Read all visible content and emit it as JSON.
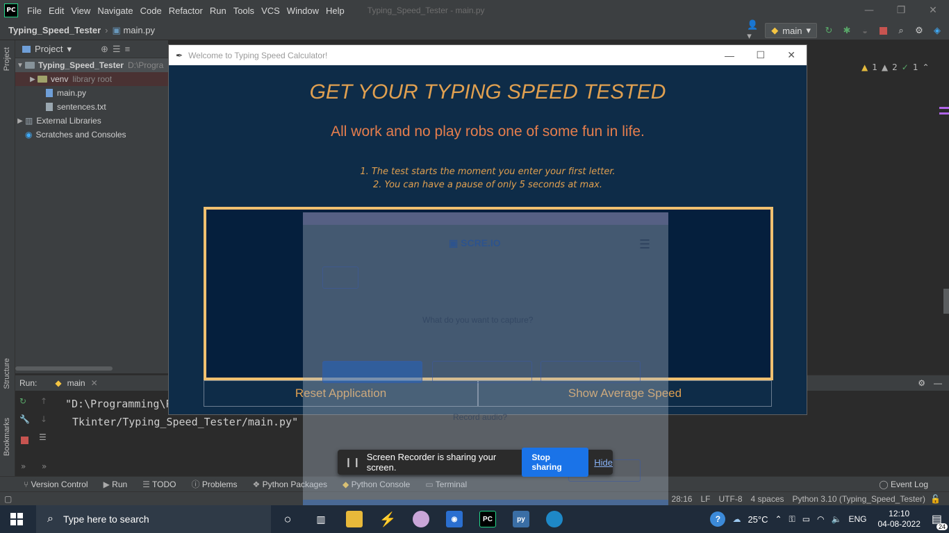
{
  "menubar": {
    "logo": "PC",
    "items": [
      "File",
      "Edit",
      "View",
      "Navigate",
      "Code",
      "Refactor",
      "Run",
      "Tools",
      "VCS",
      "Window",
      "Help"
    ],
    "title": "Typing_Speed_Tester - main.py"
  },
  "navbar": {
    "project": "Typing_Speed_Tester",
    "file": "main.py",
    "run_config": "main"
  },
  "project_panel": {
    "header": "Project",
    "root": "Typing_Speed_Tester",
    "root_path": "D:\\Progra",
    "venv": "venv",
    "venv_note": "library root",
    "main_file": "main.py",
    "sentences_file": "sentences.txt",
    "external_libraries": "External Libraries",
    "scratches": "Scratches and Consoles"
  },
  "left_strip": {
    "project": "Project",
    "structure": "Structure",
    "bookmarks": "Bookmarks"
  },
  "editor_inspections": {
    "warnings": "1",
    "weak_warnings": "2",
    "ok": "1"
  },
  "run_panel": {
    "label": "Run:",
    "tab": "main",
    "line1": "\"D:\\Programming\\P",
    "line2": "Tkinter/Typing_Speed_Tester/main.py\""
  },
  "bottom_tabs": [
    "Version Control",
    "Run",
    "TODO",
    "Problems",
    "Python Packages",
    "Python Console",
    "Terminal"
  ],
  "event_log": "Event Log",
  "status_bar": {
    "position": "28:16",
    "line_sep": "LF",
    "encoding": "UTF-8",
    "indent": "4 spaces",
    "interpreter": "Python 3.10 (Typing_Speed_Tester)"
  },
  "tk_window": {
    "title": "Welcome to Typing Speed Calculator!",
    "heading": "GET YOUR TYPING SPEED TESTED",
    "sentence": "All work and no play robs one of some fun in life.",
    "instruction1": "1. The test starts the moment you enter your first letter.",
    "instruction2": "2. You can have a pause of only 5 seconds at max.",
    "reset_button": "Reset Application",
    "average_button": "Show Average Speed"
  },
  "recorder_ghost": {
    "brand": "SCRE.IO",
    "question": "What do you want to capture?",
    "audio_question": "Record audio?"
  },
  "share_bar": {
    "message": "Screen Recorder is sharing your screen.",
    "stop": "Stop sharing",
    "hide": "Hide"
  },
  "taskbar": {
    "search_placeholder": "Type here to search",
    "temperature": "25°C",
    "language": "ENG",
    "time": "12:10",
    "date": "04-08-2022",
    "notifications": "24"
  },
  "colors": {
    "ide_bg": "#2b2b2b",
    "ide_panel": "#3c3f41",
    "tk_bg": "#0e2c48",
    "accent_gold": "#e0a050",
    "sentence_orange": "#e67e4d",
    "box_border": "#f0c070",
    "share_blue": "#1a73e8"
  }
}
